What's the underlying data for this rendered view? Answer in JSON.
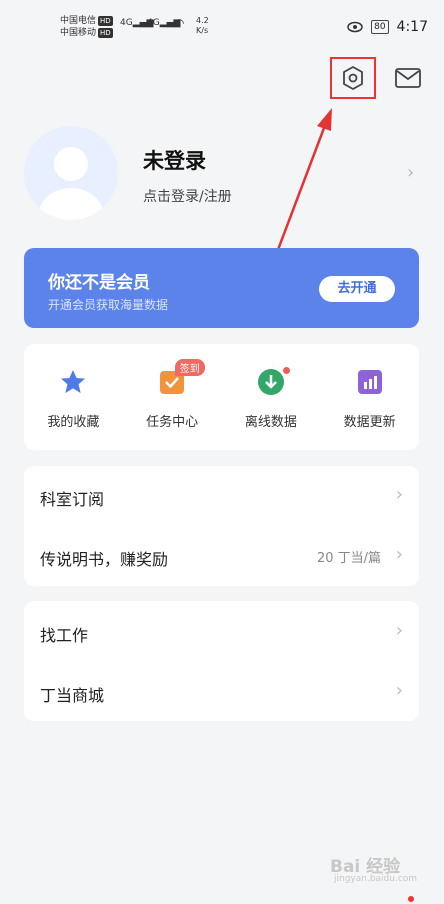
{
  "status_bar": {
    "carrier1": "中国电信",
    "carrier2": "中国移动",
    "hd": "HD",
    "net": "4G",
    "speed_value": "4.2",
    "speed_unit": "K/s",
    "battery": "80",
    "time": "4:17"
  },
  "profile": {
    "name": "未登录",
    "login_link": "点击登录/注册"
  },
  "member": {
    "title": "你还不是会员",
    "subtitle": "开通会员获取海量数据",
    "button": "去开通"
  },
  "quick_actions": [
    {
      "label": "我的收藏",
      "icon": "star-icon"
    },
    {
      "label": "任务中心",
      "icon": "task-icon",
      "badge": "签到"
    },
    {
      "label": "离线数据",
      "icon": "download-icon"
    },
    {
      "label": "数据更新",
      "icon": "chart-icon"
    }
  ],
  "menu1": [
    {
      "label": "科室订阅"
    },
    {
      "label": "传说明书，赚奖励",
      "value": "20 丁当/篇"
    }
  ],
  "menu2": [
    {
      "label": "找工作"
    },
    {
      "label": "丁当商城"
    }
  ],
  "watermark": {
    "main": "Bai 经验",
    "sub": "jingyan.baidu.com"
  },
  "colors": {
    "accent": "#5b83ea",
    "highlight": "#e33333"
  }
}
